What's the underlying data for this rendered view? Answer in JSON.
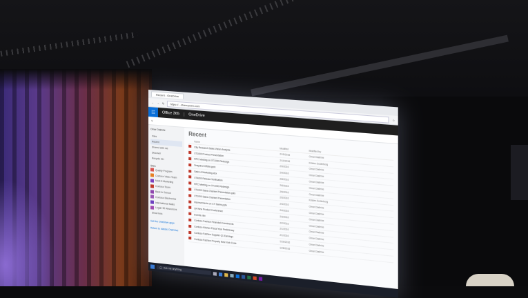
{
  "scene": {
    "browser": {
      "tab": "Recent - OneDrive",
      "url": "https://...sharepoint.com"
    },
    "suite_bar": {
      "waffle": "☷",
      "brand": "Office 365",
      "app": "OneDrive"
    },
    "nav": {
      "owner": "Omar Dialinhe",
      "items": [
        "Files",
        "Recent",
        "Shared with me",
        "Discover",
        "Recycle bin"
      ],
      "selected_index": 1,
      "groups_label": "Sites",
      "groups": [
        {
          "label": "Quality Program",
          "color": "#d9534f"
        },
        {
          "label": "Contoso Video Team",
          "color": "#e67e22"
        },
        {
          "label": "Mark 8 Marketing",
          "color": "#7b3fbf"
        },
        {
          "label": "Contoso Team",
          "color": "#c0392b"
        },
        {
          "label": "Back to School",
          "color": "#8e44ad"
        },
        {
          "label": "Contoso Electronics",
          "color": "#9b59b6"
        },
        {
          "label": "International Sales",
          "color": "#6c3fbf"
        },
        {
          "label": "Legal HR Resources",
          "color": "#a04ab0"
        }
      ],
      "more": "Show less",
      "bottom": [
        "Get the OneDrive apps",
        "Return to classic OneDrive"
      ]
    },
    "main": {
      "title": "Recent",
      "columns": [
        "Name",
        "Modified",
        "Modified by"
      ],
      "rows": [
        {
          "name": "City Research Sales Vision Analysis",
          "mod": "2/15/2016",
          "by": "Omar Dialinhe"
        },
        {
          "name": "XT1000 Product Presentation",
          "mod": "2/10/2016",
          "by": "Kristen Soderberg"
        },
        {
          "name": "RPC Meeting on XT1000 Redesign",
          "mod": "2/9/2016",
          "by": "Omar Dialinhe"
        },
        {
          "name": "Snapshot Offsite.pptx",
          "mod": "2/9/2016",
          "by": "Omar Dialinhe"
        },
        {
          "name": "Sales & Marketing.xlsx",
          "mod": "2/8/2016",
          "by": "Omar Dialinhe"
        },
        {
          "name": "XT4000 Release Notification",
          "mod": "2/8/2016",
          "by": "Omar Dialinhe"
        },
        {
          "name": "RPC Meeting on XT1000 Redesign",
          "mod": "2/5/2016",
          "by": "Omar Dialinhe"
        },
        {
          "name": "XT1000 Sales Channel Presentation.pptx",
          "mod": "2/5/2016",
          "by": "Kristen Soderberg"
        },
        {
          "name": "XT1000 Sales Channel Presentation",
          "mod": "2/4/2016",
          "by": "Omar Dialinhe"
        },
        {
          "name": "Improvements on CT Series.pptx",
          "mod": "2/4/2016",
          "by": "Omar Dialinhe"
        },
        {
          "name": "Q4 New Product Conference",
          "mod": "2/3/2016",
          "by": "Omar Dialinhe"
        },
        {
          "name": "Events.xlsx",
          "mod": "2/2/2016",
          "by": "Omar Dialinhe"
        },
        {
          "name": "Contoso Fashion Financial Investments",
          "mod": "2/1/2016",
          "by": "Omar Dialinhe"
        },
        {
          "name": "Contoso Kitchen Fiscal Year Preliminary",
          "mod": "2/1/2016",
          "by": "Omar Dialinhe"
        },
        {
          "name": "Contoso Fashion Supplier Q1 Earnings",
          "mod": "1/29/2016",
          "by": "Omar Dialinhe"
        },
        {
          "name": "Contoso Fashion Property New York Code",
          "mod": "1/28/2016",
          "by": "Omar Dialinhe"
        }
      ]
    },
    "taskbar": {
      "search_placeholder": "Ask me anything"
    }
  }
}
